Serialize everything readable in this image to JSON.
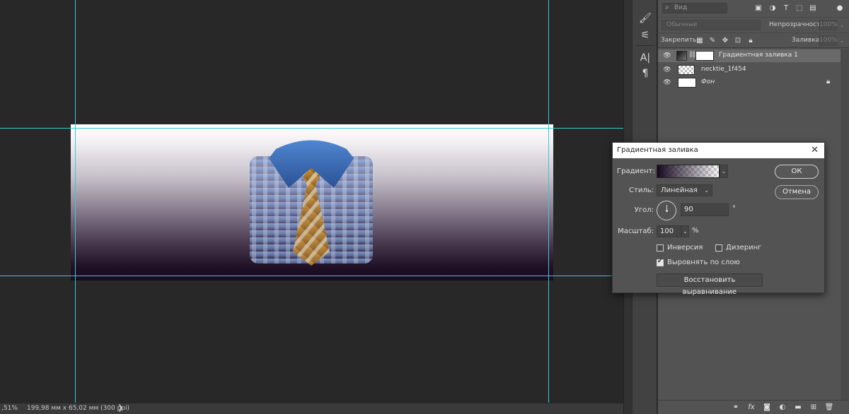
{
  "status_bar": {
    "zoom": ",51%",
    "doc_size": "199,98 мм x 65,02 мм (300 ppi)",
    "arrow": "❯"
  },
  "colors": {
    "guide": "#36c9d6",
    "panel_bg": "#535353",
    "canvas_bg": "#282828",
    "gradient_dark": "#1a0b1f"
  },
  "layers_panel": {
    "search_placeholder": "Вид",
    "blend_mode": "Обычные",
    "opacity_label": "Непрозрачность:",
    "opacity_value": "100%",
    "lock_label": "Закрепить:",
    "fill_label": "Заливка:",
    "fill_value": "100%",
    "layers": [
      {
        "name": "Градиентная заливка 1",
        "visible": true,
        "selected": true
      },
      {
        "name": "necktie_1f454",
        "visible": true,
        "selected": false
      },
      {
        "name": "Фон",
        "visible": true,
        "selected": false,
        "locked": true
      }
    ]
  },
  "dialog": {
    "title": "Градиентная заливка",
    "gradient_label": "Градиент:",
    "style_label": "Стиль:",
    "style_value": "Линейная",
    "angle_label": "Угол:",
    "angle_value": "90",
    "degree_symbol": "°",
    "scale_label": "Масштаб:",
    "scale_value": "100",
    "percent_symbol": "%",
    "reverse_label": "Инверсия",
    "reverse_checked": false,
    "dither_label": "Дизеринг",
    "dither_checked": false,
    "align_label": "Выровнять по слою",
    "align_checked": true,
    "restore_button": "Восстановить выравнивание",
    "ok_button": "ОК",
    "cancel_button": "Отмена",
    "close_icon": "✕"
  }
}
